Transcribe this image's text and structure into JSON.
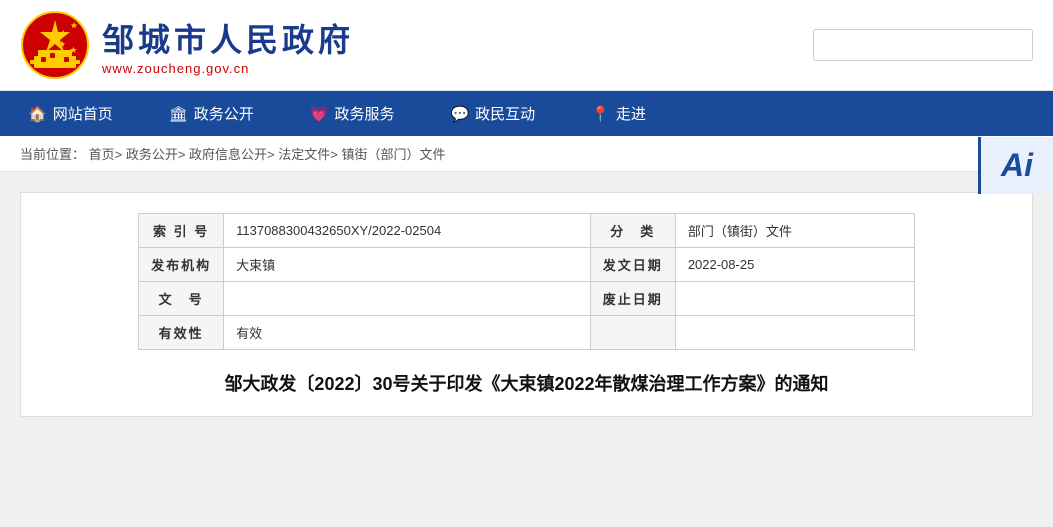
{
  "header": {
    "logo_title": "邹城市人民政府",
    "logo_url": "www.zoucheng.gov.cn",
    "search_placeholder": ""
  },
  "nav": {
    "items": [
      {
        "icon": "🏠",
        "label": "网站首页"
      },
      {
        "icon": "🏛",
        "label": "政务公开"
      },
      {
        "icon": "💗",
        "label": "政务服务"
      },
      {
        "icon": "💬",
        "label": "政民互动"
      },
      {
        "icon": "📍",
        "label": "走进"
      }
    ]
  },
  "breadcrumb": {
    "prefix": "当前位置：",
    "path": "首页> 政务公开> 政府信息公开> 法定文件> 镇街（部门）文件"
  },
  "info_table": {
    "rows": [
      {
        "col1_label": "索 引 号",
        "col1_value": "1137088300432650XY/2022-02504",
        "col2_label": "分　类",
        "col2_value": "部门（镇街）文件"
      },
      {
        "col1_label": "发布机构",
        "col1_value": "大束镇",
        "col2_label": "发文日期",
        "col2_value": "2022-08-25"
      },
      {
        "col1_label": "文　号",
        "col1_value": "",
        "col2_label": "废止日期",
        "col2_value": ""
      },
      {
        "col1_label": "有效性",
        "col1_value": "有效",
        "col2_label": "",
        "col2_value": ""
      }
    ]
  },
  "article": {
    "title": "邹大政发〔2022〕30号关于印发《大束镇2022年散煤治理工作方案》的通知"
  },
  "ai_badge": {
    "label": "Ai"
  }
}
